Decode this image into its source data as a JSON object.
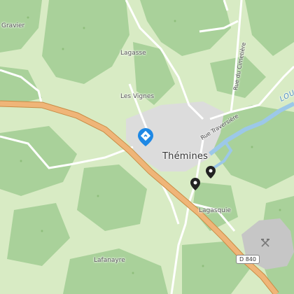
{
  "map": {
    "labels": {
      "gravier": "Gravier",
      "lagasse": "Lagasse",
      "les_vignes": "Les Vignes",
      "themines": "Thémines",
      "rue_traversiere": "Rue Traversière",
      "rue_du_cimetiere": "Rue du Cimetière",
      "lagasquie": "Lagasquie",
      "lafanayre": "Lafanayre",
      "river": "LOU",
      "route_badge": "D 840"
    },
    "icons": {
      "marker": "blue-diamond-marker-icon",
      "poi_a": "black-pin-icon",
      "poi_b": "black-pin-icon",
      "quarry": "hammer-pick-icon"
    },
    "colors": {
      "meadow": "#d8ebc4",
      "forest": "#a9d19a",
      "main_road": "#efb578",
      "main_road_casing": "#c98c45",
      "village": "#dcdcdc",
      "water": "#9cc8e8",
      "marker": "#1e88e5"
    }
  }
}
